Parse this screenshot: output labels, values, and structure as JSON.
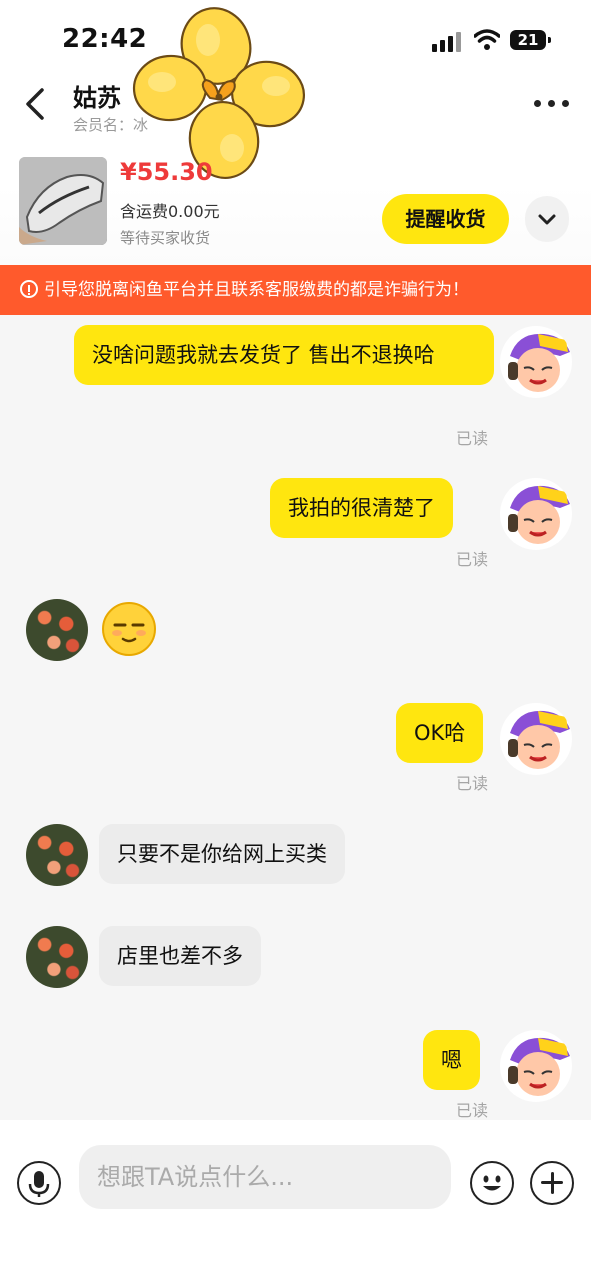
{
  "status_bar": {
    "time": "22:42",
    "battery": "21"
  },
  "header": {
    "contact_name": "姑苏",
    "member_label": "会员名：冰",
    "more_icon": "more-icon",
    "back_icon": "back-chevron-icon"
  },
  "product": {
    "price": "¥55.30",
    "shipping": "含运费0.00元",
    "status": "等待买家收货",
    "remind_button": "提醒收货"
  },
  "warning": {
    "text": "引导您脱离闲鱼平台并且联系客服缴费的都是诈骗行为！",
    "color": "#ff5a2c"
  },
  "messages": [
    {
      "side": "me",
      "text": "没啥问题我就去发货了 售出不退换哈",
      "read": "已读"
    },
    {
      "side": "me",
      "text": "我拍的很清楚了",
      "read": "已读"
    },
    {
      "side": "them",
      "type": "emoji",
      "emoji": "smug-face-emoji"
    },
    {
      "side": "me",
      "text": "OK哈",
      "read": "已读"
    },
    {
      "side": "them",
      "text": "只要不是你给网上买类"
    },
    {
      "side": "them",
      "text": "店里也差不多"
    },
    {
      "side": "me",
      "text": "嗯",
      "read": "已读"
    }
  ],
  "composer": {
    "placeholder": "想跟TA说点什么..."
  },
  "colors": {
    "accent": "#ffe60f",
    "price": "#ee3a3a"
  }
}
